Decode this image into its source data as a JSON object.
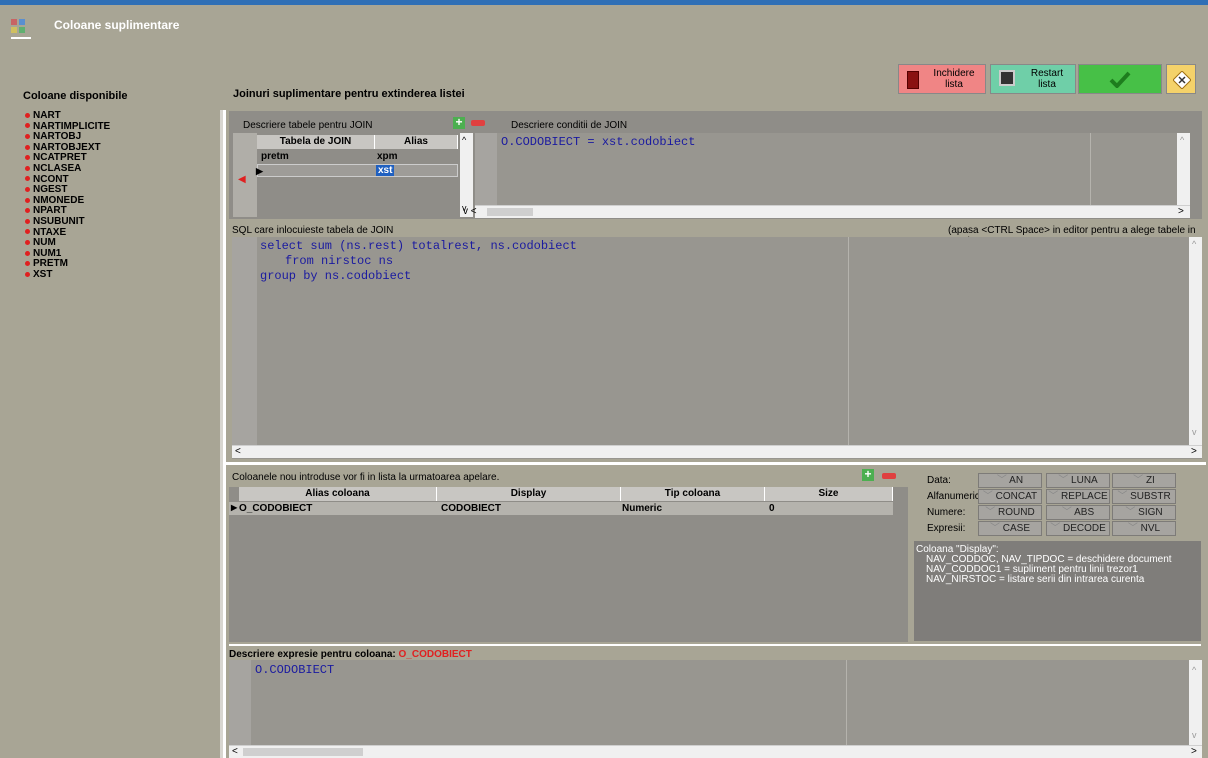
{
  "window": {
    "title": "Coloane suplimentare"
  },
  "sidebar": {
    "title": "Coloane disponibile",
    "items": [
      "NART",
      "NARTIMPLICITE",
      "NARTOBJ",
      "NARTOBJEXT",
      "NCATPRET",
      "NCLASEA",
      "NCONT",
      "NGEST",
      "NMONEDE",
      "NPART",
      "NSUBUNIT",
      "NTAXE",
      "NUM",
      "NUM1",
      "PRETM",
      "XST"
    ]
  },
  "main_title": "Joinuri suplimentare pentru extinderea listei",
  "toolbar": {
    "close_label": "Inchidere lista",
    "restart_label": "Restart lista"
  },
  "join": {
    "tables_label": "Descriere tabele pentru JOIN",
    "conditions_label": "Descriere conditii de JOIN",
    "headers": [
      "Tabela de JOIN",
      "Alias"
    ],
    "rows": [
      [
        "pretm",
        "xpm"
      ],
      [
        "",
        "xst"
      ]
    ],
    "condition": "O.CODOBIECT = xst.codobiect"
  },
  "sql": {
    "label": "SQL care inlocuieste tabela de JOIN",
    "hint": "(apasa <CTRL Space> in editor pentru a alege tabele in SQL)",
    "line1": "select sum (ns.rest) totalrest, ns.codobiect",
    "line2": "from nirstoc ns",
    "line3": "group by ns.codobiect"
  },
  "columns": {
    "label": "Coloanele nou introduse vor fi in lista la urmatoarea apelare.",
    "headers": [
      "Alias coloana",
      "Display",
      "Tip coloana",
      "Size"
    ],
    "row": [
      "O_CODOBIECT",
      "CODOBIECT",
      "Numeric",
      "0"
    ]
  },
  "functions": {
    "data_label": "Data:",
    "data": [
      "AN",
      "LUNA",
      "ZI"
    ],
    "alfa_label": "Alfanumeric:",
    "alfa": [
      "CONCAT",
      "REPLACE",
      "SUBSTR"
    ],
    "num_label": "Numere:",
    "num": [
      "ROUND",
      "ABS",
      "SIGN"
    ],
    "expr_label": "Expresii:",
    "expr": [
      "CASE",
      "DECODE",
      "NVL"
    ]
  },
  "display_help": {
    "line1": "Coloana \"Display\":",
    "line2": "NAV_CODDOC, NAV_TIPDOC = deschidere document",
    "line3": "NAV_CODDOC1 = supliment pentru linii trezor1",
    "line4": "NAV_NIRSTOC = listare serii din intrarea curenta"
  },
  "expression": {
    "label": "Descriere expresie pentru coloana:",
    "column": "O_CODOBIECT",
    "text": "O.CODOBIECT"
  },
  "colors": {
    "accent_red": "#e02020",
    "keyword_blue": "#1a1aa0",
    "ok_green": "#3fb53f",
    "close_red": "#f08080"
  }
}
